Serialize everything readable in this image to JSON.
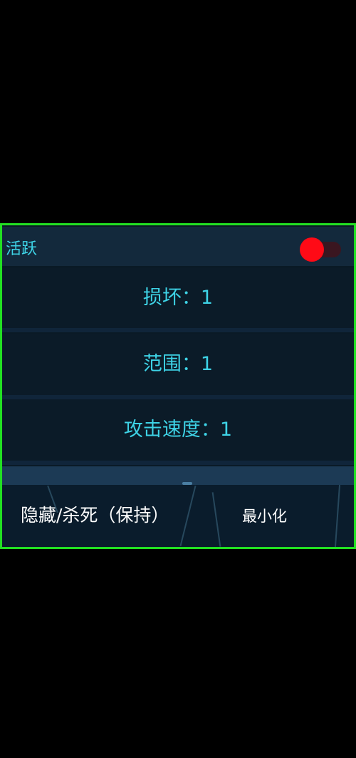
{
  "menu": {
    "active_label": "活跃",
    "active_toggle_on": true,
    "rows": [
      {
        "label": "损坏：1"
      },
      {
        "label": "范围：1"
      },
      {
        "label": "攻击速度：1"
      }
    ],
    "hide_kill_label": "隐藏/杀死（保持）",
    "minimize_label": "最小化"
  },
  "colors": {
    "border": "#22e022",
    "accent_text": "#3ed3e6",
    "toggle_knob": "#ff0a16",
    "panel_bg": "#0a1a26"
  }
}
